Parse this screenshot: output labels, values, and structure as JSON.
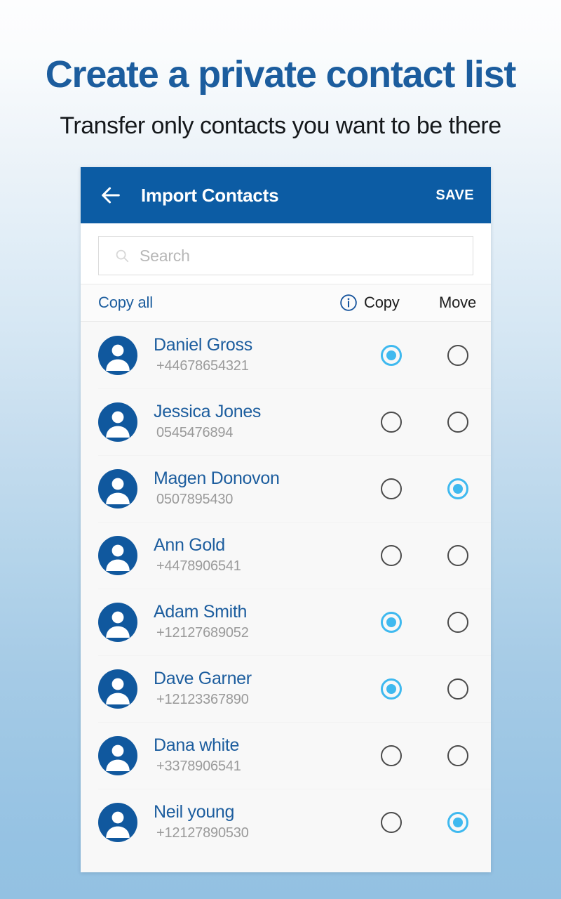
{
  "promo": {
    "headline": "Create a private contact list",
    "subheadline": "Transfer only contacts you want to be there",
    "headline_color": "#1c5d9e",
    "background_top": "#fdfdfe",
    "background_bottom": "#93c1e2"
  },
  "app_bar": {
    "back_icon": "arrow-left-icon",
    "title": "Import Contacts",
    "save_label": "SAVE",
    "background_color": "#0c5ca4",
    "text_color": "#ffffff"
  },
  "search": {
    "icon": "search-icon",
    "placeholder": "Search",
    "value": ""
  },
  "columns": {
    "copy_all_label": "Copy all",
    "info_icon": "info-circle-icon",
    "copy_label": "Copy",
    "move_label": "Move",
    "link_color": "#1c5d9e"
  },
  "radio": {
    "selected_color": "#3fb9ef",
    "unselected_color": "#4a4a4a"
  },
  "contacts": [
    {
      "name": "Daniel Gross",
      "phone": "+44678654321",
      "copy": true,
      "move": false,
      "avatar": "person-avatar-icon"
    },
    {
      "name": "Jessica Jones",
      "phone": "0545476894",
      "copy": false,
      "move": false,
      "avatar": "person-avatar-icon"
    },
    {
      "name": "Magen Donovon",
      "phone": "0507895430",
      "copy": false,
      "move": true,
      "avatar": "person-avatar-icon"
    },
    {
      "name": "Ann Gold",
      "phone": "+4478906541",
      "copy": false,
      "move": false,
      "avatar": "person-avatar-icon"
    },
    {
      "name": "Adam Smith",
      "phone": "+12127689052",
      "copy": true,
      "move": false,
      "avatar": "person-avatar-icon"
    },
    {
      "name": "Dave Garner",
      "phone": "+12123367890",
      "copy": true,
      "move": false,
      "avatar": "person-avatar-icon"
    },
    {
      "name": "Dana white",
      "phone": "+3378906541",
      "copy": false,
      "move": false,
      "avatar": "person-avatar-icon"
    },
    {
      "name": "Neil young",
      "phone": "+12127890530",
      "copy": false,
      "move": true,
      "avatar": "person-avatar-icon"
    }
  ]
}
